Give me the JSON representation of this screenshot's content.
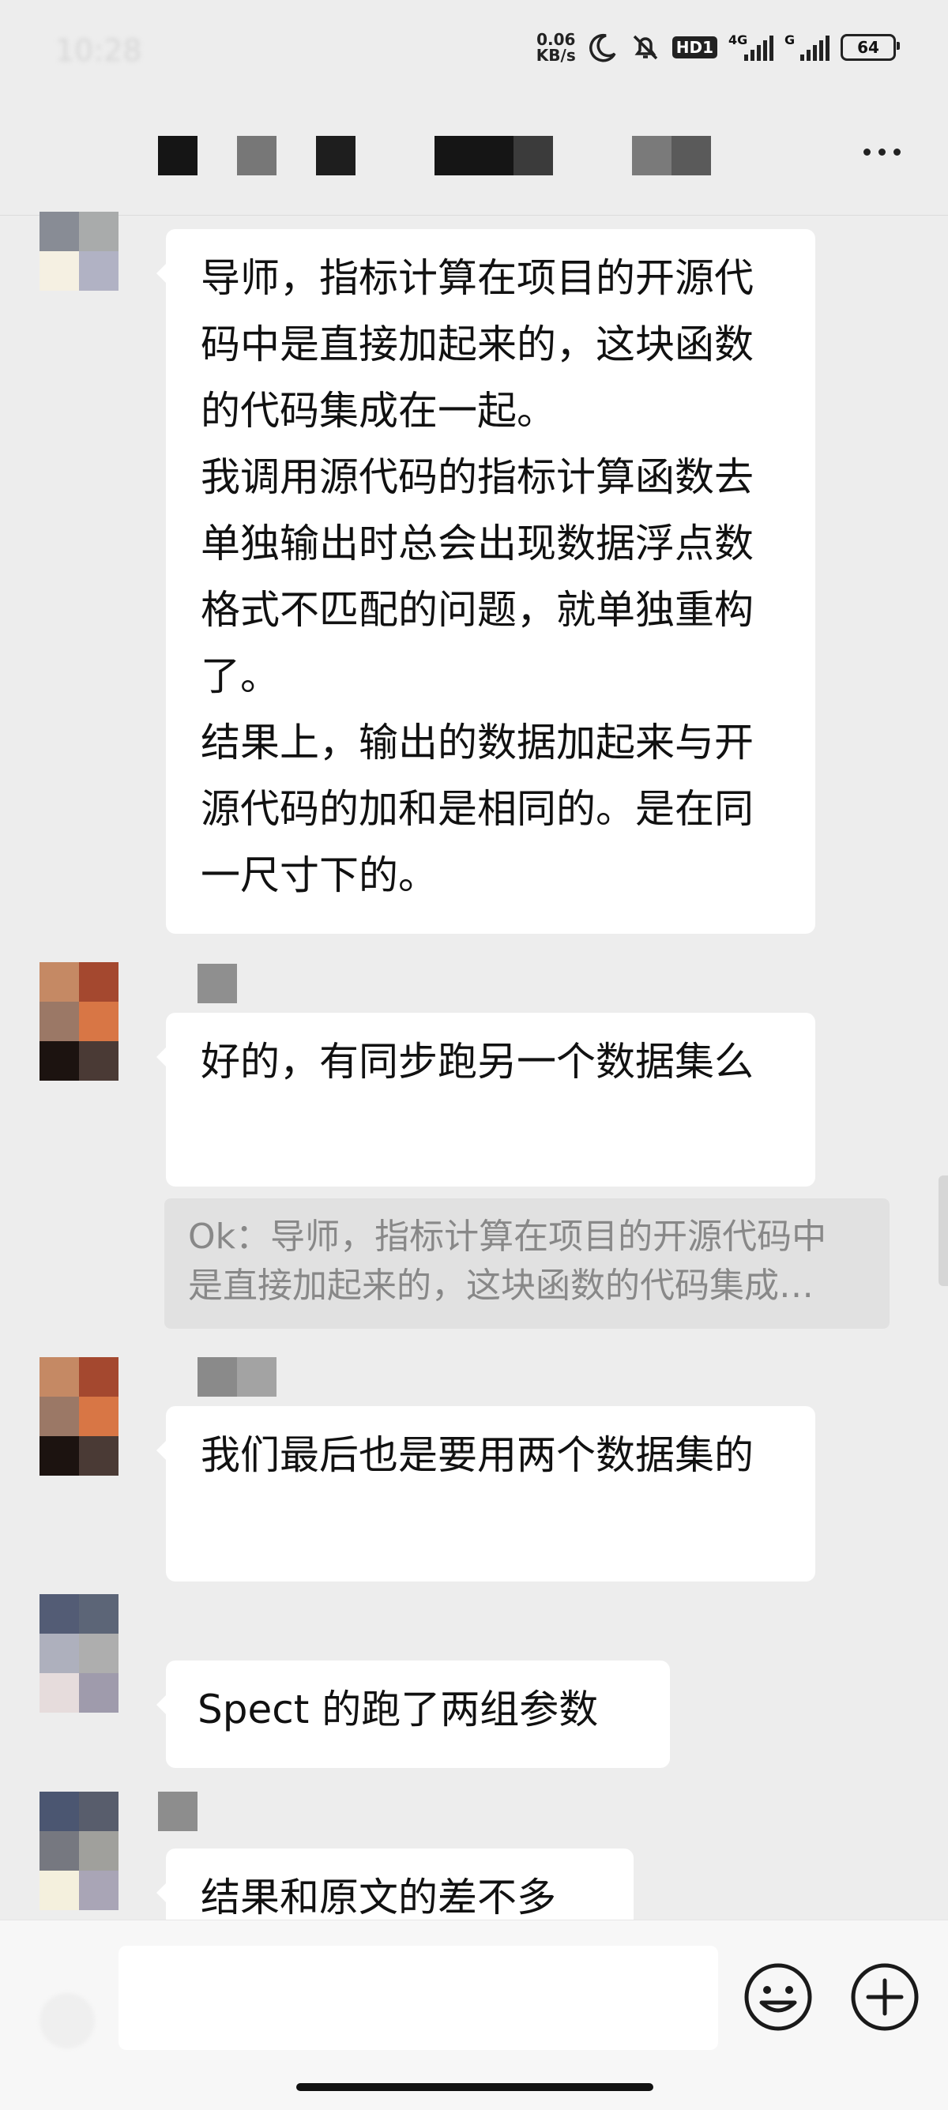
{
  "status_bar": {
    "time": "10:28",
    "net_speed_value": "0.06",
    "net_speed_unit": "KB/s",
    "hd_label": "HD1",
    "signal_1_label": "4G",
    "signal_2_label": "G",
    "battery": "64"
  },
  "header": {
    "title_icon": "pixelated-title",
    "more_icon": "more-dots-icon"
  },
  "messages": [
    {
      "lines": [
        "导师，指标计算在项目的开源代码中是直接加起来的，这块函数的代码集成在一起。",
        "我调用源代码的指标计算函数去单独输出时总会出现数据浮点数格式不匹配的问题，就单独重构了。",
        "结果上，输出的数据加起来与开源代码的加和是相同的。是在同一尺寸下的。"
      ]
    },
    {
      "lines": [
        "好的，有同步跑另一个数据集么"
      ]
    },
    {
      "lines": [
        "我们最后也是要用两个数据集的"
      ]
    },
    {
      "lines": [
        "Spect 的跑了两组参数"
      ]
    },
    {
      "lines": [
        "结果和原文的差不多"
      ]
    }
  ],
  "quote": {
    "line1": "Ok：导师，指标计算在项目的开源代码中",
    "line2": "是直接加起来的，这块函数的代码集成…"
  },
  "input_bar": {
    "emoji_icon": "emoji-icon",
    "plus_icon": "plus-icon"
  },
  "colors": {
    "background": "#ededed",
    "bubble": "#ffffff",
    "quote_bg": "#e1e1e1",
    "quote_text": "#888888"
  }
}
